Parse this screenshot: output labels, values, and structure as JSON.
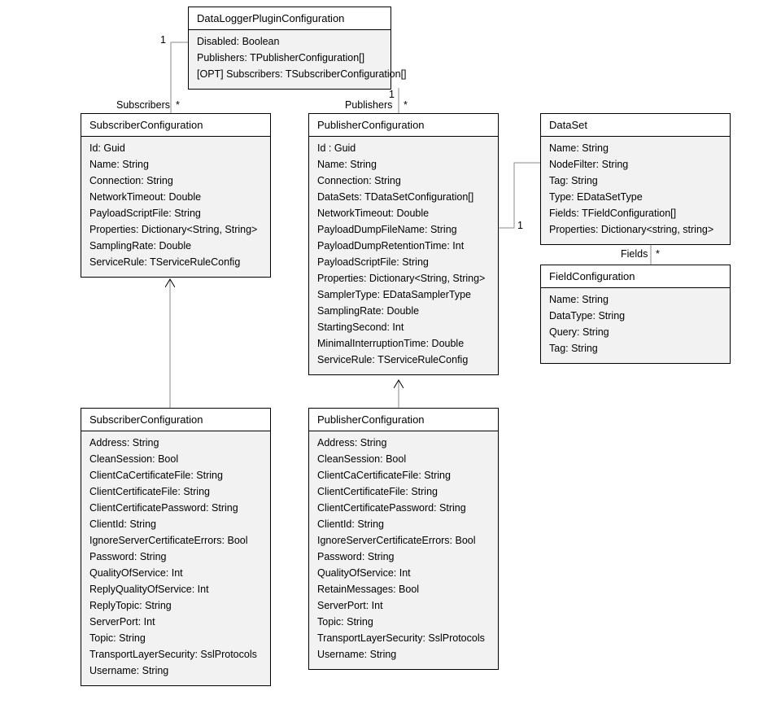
{
  "labels": {
    "subscribers": "Subscribers",
    "publishers": "Publishers",
    "fields": "Fields",
    "one_a": "1",
    "one_b": "1",
    "one_c": "1",
    "star_a": "*",
    "star_b": "*",
    "star_c": "*"
  },
  "classes": {
    "dlpc": {
      "title": "DataLoggerPluginConfiguration",
      "attrs": [
        "Disabled: Boolean",
        "Publishers: TPublisherConfiguration[]",
        "[OPT] Subscribers: TSubscriberConfiguration[]"
      ]
    },
    "subTop": {
      "title": "SubscriberConfiguration",
      "attrs": [
        "Id: Guid",
        "Name: String",
        "Connection: String",
        "NetworkTimeout: Double",
        "PayloadScriptFile: String",
        "Properties: Dictionary<String, String>",
        "SamplingRate: Double",
        "ServiceRule: TServiceRuleConfig"
      ]
    },
    "pubTop": {
      "title": "PublisherConfiguration",
      "attrs": [
        "Id : Guid",
        "Name: String",
        "Connection: String",
        "DataSets: TDataSetConfiguration[]",
        "NetworkTimeout: Double",
        "PayloadDumpFileName: String",
        "PayloadDumpRetentionTime: Int",
        "PayloadScriptFile: String",
        "Properties: Dictionary<String, String>",
        "SamplerType: EDataSamplerType",
        "SamplingRate: Double",
        "StartingSecond: Int",
        "MinimalInterruptionTime: Double",
        "ServiceRule: TServiceRuleConfig"
      ]
    },
    "dataset": {
      "title": "DataSet",
      "attrs": [
        "Name: String",
        "NodeFilter: String",
        "Tag: String",
        "Type: EDataSetType",
        "Fields: TFieldConfiguration[]",
        "Properties: Dictionary<string, string>"
      ]
    },
    "fieldcfg": {
      "title": "FieldConfiguration",
      "attrs": [
        "Name: String",
        "DataType: String",
        "Query: String",
        "Tag: String"
      ]
    },
    "subBot": {
      "title": "SubscriberConfiguration",
      "attrs": [
        "Address: String",
        "CleanSession: Bool",
        "ClientCaCertificateFile: String",
        "ClientCertificateFile: String",
        "ClientCertificatePassword: String",
        "ClientId: String",
        "IgnoreServerCertificateErrors: Bool",
        "Password: String",
        "QualityOfService: Int",
        "ReplyQualityOfService: Int",
        "ReplyTopic: String",
        "ServerPort: Int",
        "Topic: String",
        "TransportLayerSecurity: SslProtocols",
        "Username: String"
      ]
    },
    "pubBot": {
      "title": "PublisherConfiguration",
      "attrs": [
        "Address: String",
        "CleanSession: Bool",
        "ClientCaCertificateFile: String",
        "ClientCertificateFile: String",
        "ClientCertificatePassword: String",
        "ClientId: String",
        "IgnoreServerCertificateErrors: Bool",
        "Password: String",
        "QualityOfService: Int",
        "RetainMessages: Bool",
        "ServerPort: Int",
        "Topic: String",
        "TransportLayerSecurity: SslProtocols",
        "Username: String"
      ]
    }
  }
}
